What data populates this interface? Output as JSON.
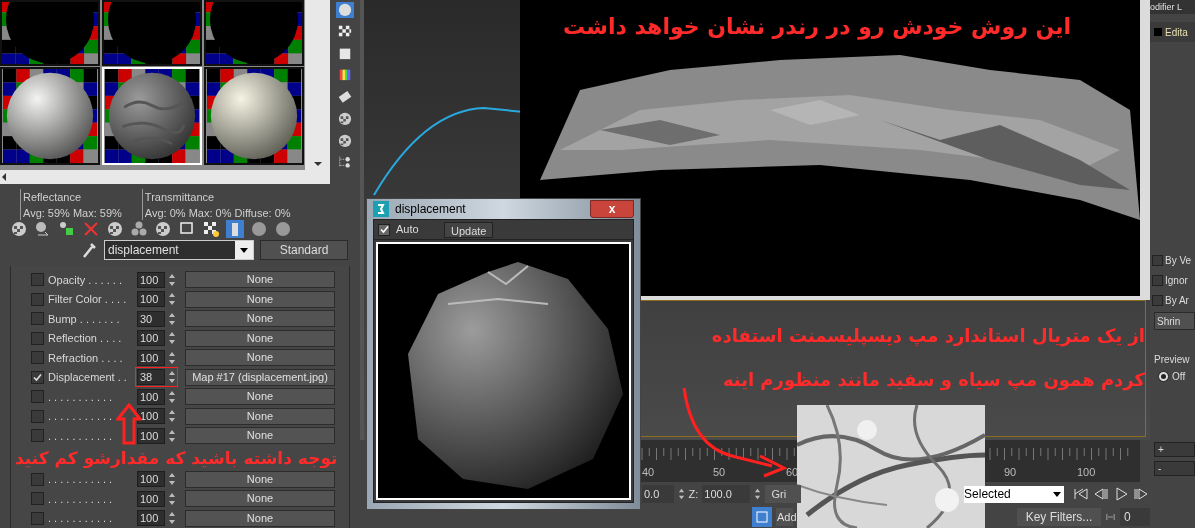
{
  "material_editor": {
    "sample_type_active": true,
    "sample_slots": [
      {
        "kind": "black",
        "selected": false
      },
      {
        "kind": "black",
        "selected": false
      },
      {
        "kind": "black",
        "selected": false
      },
      {
        "kind": "white",
        "selected": false
      },
      {
        "kind": "bumpy",
        "selected": true
      },
      {
        "kind": "cream",
        "selected": false
      }
    ],
    "reflectance": {
      "label": "Reflectance",
      "values": "Avg: 59% Max: 59%"
    },
    "transmittance": {
      "label": "Transmittance",
      "values": "Avg: 0% Max: 0% Diffuse: 0%"
    },
    "show_map_active": true,
    "material_name": "displacement",
    "material_type": "Standard",
    "maps": [
      {
        "label": "Opacity . . . . . .",
        "checked": false,
        "amount": "100",
        "map": "None",
        "highlighted": false
      },
      {
        "label": "Filter Color . . . .",
        "checked": false,
        "amount": "100",
        "map": "None",
        "highlighted": false
      },
      {
        "label": "Bump . . . . . . .",
        "checked": false,
        "amount": "30",
        "map": "None",
        "highlighted": false
      },
      {
        "label": "Reflection . . . .",
        "checked": false,
        "amount": "100",
        "map": "None",
        "highlighted": false
      },
      {
        "label": "Refraction . . . .",
        "checked": false,
        "amount": "100",
        "map": "None",
        "highlighted": false
      },
      {
        "label": "Displacement . .",
        "checked": true,
        "amount": "38",
        "map": "Map #17 (displacement.jpg)",
        "highlighted": true
      },
      {
        "label": ". . . . . . . . . . .",
        "checked": false,
        "amount": "100",
        "map": "None",
        "highlighted": false
      },
      {
        "label": ". . . . . . . . . . .",
        "checked": false,
        "amount": "100",
        "map": "None",
        "highlighted": false
      },
      {
        "label": ". . . . . . . . . . .",
        "checked": false,
        "amount": "100",
        "map": "None",
        "highlighted": false
      },
      {
        "label": ". . . . . . . . . . .",
        "checked": false,
        "amount": "100",
        "map": "None",
        "highlighted": false
      },
      {
        "label": ". . . . . . . . . . .",
        "checked": false,
        "amount": "100",
        "map": "None",
        "highlighted": false
      },
      {
        "label": ". . . . . . . . . . .",
        "checked": false,
        "amount": "100",
        "map": "None",
        "highlighted": false
      }
    ]
  },
  "preview_window": {
    "title": "displacement",
    "close": "x",
    "auto": {
      "label": "Auto",
      "checked": true
    },
    "update": "Update"
  },
  "timeline": {
    "ticks": [
      "40",
      "50",
      "60",
      "90",
      "100"
    ]
  },
  "status_bar": {
    "x_value": "0.0",
    "z_label": "Z:",
    "z_value": "100.0",
    "grid": "Gri",
    "add_time_tag": "Add",
    "selection": "Selected",
    "key_filters": "Key Filters...",
    "frame": "0"
  },
  "command_panel": {
    "modifier_list": "odifier L",
    "stack_item": "Edita",
    "checks": [
      {
        "label": "By Ve",
        "checked": false
      },
      {
        "label": "Ignor",
        "checked": false
      },
      {
        "label": "By Ar",
        "checked": false
      }
    ],
    "shrink": "Shrin",
    "preview_label": "Preview",
    "preview_off": {
      "label": "Off",
      "selected": true
    },
    "plus": "+",
    "minus": "-"
  },
  "annotations": [
    {
      "text": "این روش خودش رو در رندر نشان خواهد داشت"
    },
    {
      "text": "از یک متریال استاندارد مپ دیسپلیسمنت استفاده"
    },
    {
      "text": "کردم همون مپ سیاه و سفید مانند منظورم اینه"
    },
    {
      "text": "توجه داشته باشید که مقدارشو کم کنید"
    }
  ]
}
